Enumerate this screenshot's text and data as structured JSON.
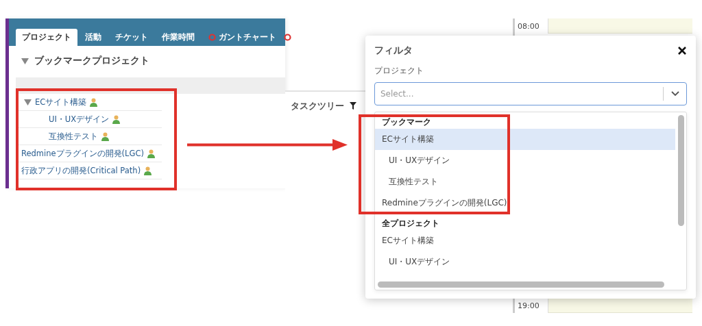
{
  "project_panel": {
    "tabs": [
      {
        "label": "プロジェクト",
        "selected": true,
        "has_icon": false
      },
      {
        "label": "活動",
        "selected": false,
        "has_icon": false
      },
      {
        "label": "チケット",
        "selected": false,
        "has_icon": false
      },
      {
        "label": "作業時間",
        "selected": false,
        "has_icon": false
      },
      {
        "label": "ガントチャート",
        "selected": false,
        "has_icon": true
      }
    ],
    "section_title": "ブックマークプロジェクト",
    "section_expanded": true,
    "projects": [
      {
        "name": "ECサイト構築",
        "expanded": true,
        "children": [
          {
            "name": "UI・UXデザイン"
          },
          {
            "name": "互換性テスト"
          }
        ]
      },
      {
        "name": "Redmineプラグインの開発(LGC)"
      },
      {
        "name": "行政アプリの開発(Critical Path)"
      }
    ]
  },
  "task_tree": {
    "title": "タスクツリー"
  },
  "calendar": {
    "times": [
      "08:00",
      "19:00"
    ]
  },
  "filter_dialog": {
    "title": "フィルタ",
    "field_label": "プロジェクト",
    "placeholder": "Select...",
    "groups": [
      {
        "label": "ブックマーク",
        "items": [
          {
            "name": "ECサイト構築",
            "selected": true,
            "children": [
              {
                "name": "UI・UXデザイン",
                "selected": false
              },
              {
                "name": "互換性テスト",
                "selected": false
              }
            ]
          },
          {
            "name": "Redmineプラグインの開発(LGC)",
            "selected": false
          }
        ]
      },
      {
        "label": "全プロジェクト",
        "items": [
          {
            "name": "ECサイト構築",
            "selected": false,
            "children": [
              {
                "name": "UI・UXデザイン",
                "selected": false
              }
            ]
          }
        ]
      }
    ]
  }
}
